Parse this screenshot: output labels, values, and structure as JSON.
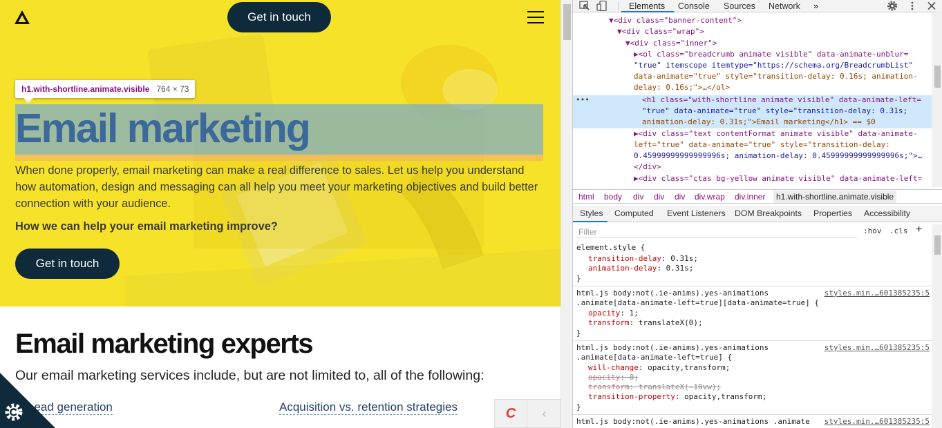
{
  "site": {
    "header_cta": "Get in touch",
    "hero": {
      "title": "Email marketing",
      "intro": "When done properly, email marketing can make a real difference to sales. Let us help you understand how automation, design and messaging can all help you meet your marketing objectives and build better connection with your audience.",
      "question": "How we can help your email marketing improve?",
      "cta": "Get in touch"
    },
    "inspect_tooltip": {
      "selector": "h1.with-shortline.animate.visible",
      "size": "764 × 73"
    },
    "experts": {
      "title": "Email marketing experts",
      "lead": "Our email marketing services include, but are not limited to, all of the following:",
      "services": [
        "Lead generation",
        "Acquisition vs. retention strategies"
      ]
    },
    "chat_label": "C",
    "chat_chevron": "‹"
  },
  "devtools": {
    "tabs": [
      "Elements",
      "Console",
      "Sources",
      "Network",
      "»"
    ],
    "active_tab": "Elements",
    "dom_lines": [
      {
        "t": "▼<div class=\"banner-content\">"
      },
      {
        "t": "▼<div class=\"wrap\">"
      },
      {
        "t": "▼<div class=\"inner\">"
      },
      {
        "t": "▶<ol class=\"breadcrumb animate visible\" data-animate-unblur="
      },
      {
        "t": "\"true\" itemscope itemtype=\"https://schema.org/BreadcrumbList\""
      },
      {
        "t": "data-animate=\"true\" style=\"transition-delay: 0.16s; animation-"
      },
      {
        "t": "delay: 0.16s;\">…</ol>"
      },
      {
        "t": "<h1 class=\"with-shortline animate visible\" data-animate-left="
      },
      {
        "t": "\"true\" data-animate=\"true\" style=\"transition-delay: 0.31s;"
      },
      {
        "t": "animation-delay: 0.31s;\">Email marketing</h1> == $0"
      },
      {
        "t": "▶<div class=\"text contentFormat animate visible\" data-animate-"
      },
      {
        "t": "left=\"true\" data-animate=\"true\" style=\"transition-delay:"
      },
      {
        "t": "0.45999999999999996s; animation-delay: 0.45999999999999996s;\">…"
      },
      {
        "t": "</div>"
      },
      {
        "t": "▶<div class=\"ctas bg-yellow animate visible\" data-animate-left="
      }
    ],
    "selected_marker": "•••",
    "breadcrumbs": [
      "html",
      "body",
      "div",
      "div",
      "div",
      "div.wrap",
      "div.inner",
      "h1.with-shortline.animate.visible"
    ],
    "style_tabs": [
      "Styles",
      "Computed",
      "Event Listeners",
      "DOM Breakpoints",
      "Properties",
      "Accessibility"
    ],
    "filter_placeholder": "Filter",
    "hov": ":hov",
    "cls": ".cls",
    "plus": "+",
    "rules": [
      {
        "selector": "element.style {",
        "source": "",
        "props": [
          {
            "name": "transition-delay",
            "value": "0.31s;",
            "struck": false
          },
          {
            "name": "animation-delay",
            "value": "0.31s;",
            "struck": false
          }
        ],
        "close": "}"
      },
      {
        "selector": "html.js body:not(.ie-anims).yes-animations",
        "selector2": ".animate[data-animate-left=true][data-animate=true] {",
        "source": "styles.min.…601385235:5",
        "props": [
          {
            "name": "opacity",
            "value": "1;",
            "struck": false
          },
          {
            "name": "transform",
            "value": "translateX(0);",
            "struck": false
          }
        ],
        "close": "}"
      },
      {
        "selector": "html.js body:not(.ie-anims).yes-animations",
        "selector2": ".animate[data-animate-left=true] {",
        "source": "styles.min.…601385235:5",
        "props": [
          {
            "name": "will-change",
            "value": "opacity,transform;",
            "struck": false
          },
          {
            "name": "opacity",
            "value": "0;",
            "struck": true
          },
          {
            "name": "transform",
            "value": "translateX(-10vw);",
            "struck": true
          },
          {
            "name": "transition-property",
            "value": "opacity,transform;",
            "struck": false
          }
        ],
        "close": "}"
      },
      {
        "selector": "html.js body:not(.ie-anims).yes-animations .animate",
        "source": "styles.min.…601385235:5",
        "props": [],
        "close": ""
      }
    ]
  }
}
